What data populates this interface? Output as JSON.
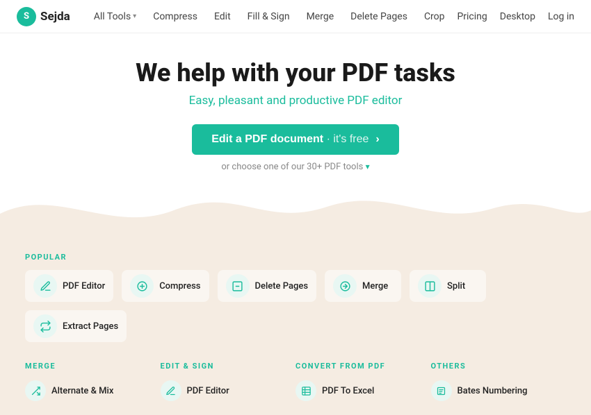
{
  "nav": {
    "logo_letter": "S",
    "logo_name": "Sejda",
    "links": [
      {
        "label": "All Tools",
        "has_dropdown": true
      },
      {
        "label": "Compress",
        "has_dropdown": false
      },
      {
        "label": "Edit",
        "has_dropdown": false
      },
      {
        "label": "Fill & Sign",
        "has_dropdown": false
      },
      {
        "label": "Merge",
        "has_dropdown": false
      },
      {
        "label": "Delete Pages",
        "has_dropdown": false
      },
      {
        "label": "Crop",
        "has_dropdown": false
      }
    ],
    "right_links": [
      {
        "label": "Pricing"
      },
      {
        "label": "Desktop"
      },
      {
        "label": "Log in"
      }
    ]
  },
  "hero": {
    "title": "We help with your PDF tasks",
    "subtitle": "Easy, pleasant and productive PDF editor",
    "cta_label": "Edit a PDF document",
    "cta_suffix": "· it's free",
    "cta_sub": "or choose one of our 30+ PDF tools"
  },
  "popular": {
    "section_label": "POPULAR",
    "tools": [
      {
        "name": "PDF Editor",
        "icon": "edit"
      },
      {
        "name": "Compress",
        "icon": "compress"
      },
      {
        "name": "Delete Pages",
        "icon": "delete"
      },
      {
        "name": "Merge",
        "icon": "merge"
      },
      {
        "name": "Split",
        "icon": "split"
      },
      {
        "name": "Extract Pages",
        "icon": "extract"
      }
    ]
  },
  "bottom_sections": [
    {
      "label": "MERGE",
      "tools": [
        {
          "name": "Alternate & Mix",
          "icon": "alternate"
        }
      ]
    },
    {
      "label": "EDIT & SIGN",
      "tools": [
        {
          "name": "PDF Editor",
          "icon": "edit"
        }
      ]
    },
    {
      "label": "CONVERT FROM PDF",
      "tools": [
        {
          "name": "PDF To Excel",
          "icon": "excel"
        }
      ]
    },
    {
      "label": "OTHERS",
      "tools": [
        {
          "name": "Bates Numbering",
          "icon": "bates"
        }
      ]
    }
  ]
}
